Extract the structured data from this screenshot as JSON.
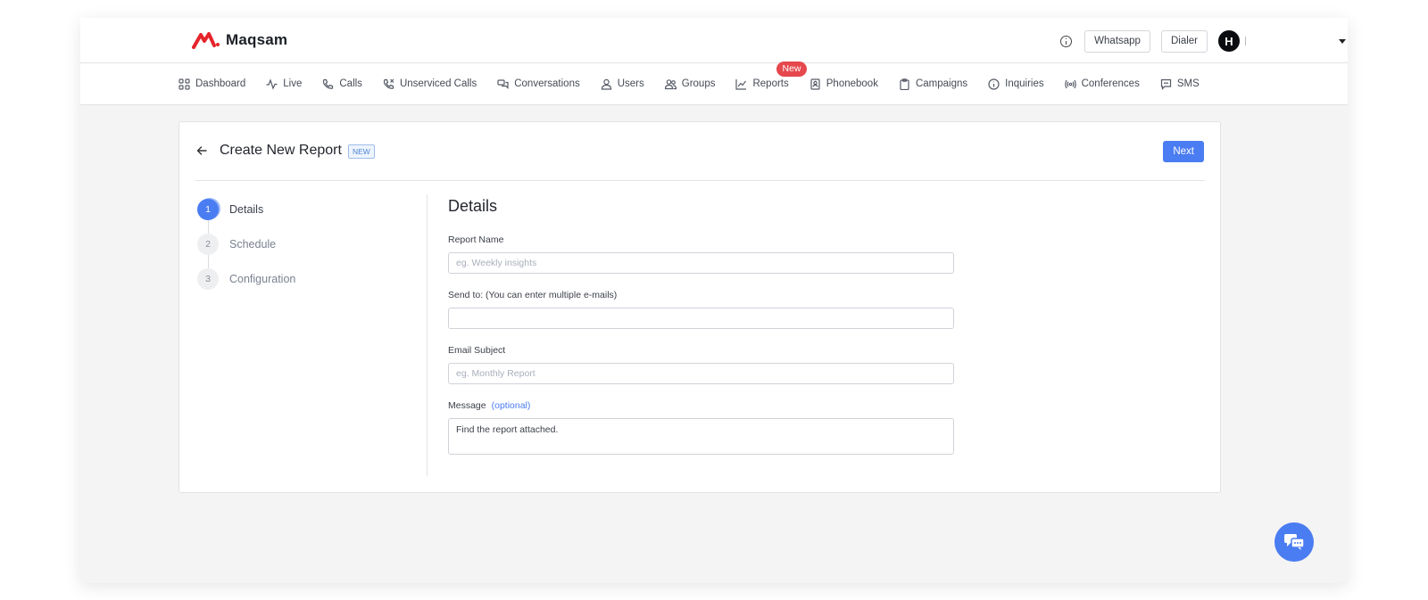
{
  "brand": {
    "name": "Maqsam",
    "color": "#e5242b"
  },
  "header": {
    "whatsapp_label": "Whatsapp",
    "dialer_label": "Dialer",
    "avatar_initial": "H"
  },
  "nav": {
    "items": [
      {
        "label": "Dashboard",
        "icon": "grid-icon"
      },
      {
        "label": "Live",
        "icon": "pulse-icon"
      },
      {
        "label": "Calls",
        "icon": "phone-icon"
      },
      {
        "label": "Unserviced Calls",
        "icon": "phone-missed-icon"
      },
      {
        "label": "Conversations",
        "icon": "chat-bubbles-icon"
      },
      {
        "label": "Users",
        "icon": "user-icon"
      },
      {
        "label": "Groups",
        "icon": "users-icon"
      },
      {
        "label": "Reports",
        "icon": "chart-line-icon"
      },
      {
        "label": "Phonebook",
        "icon": "contact-book-icon"
      },
      {
        "label": "Campaigns",
        "icon": "clipboard-icon"
      },
      {
        "label": "Inquiries",
        "icon": "info-circle-icon"
      },
      {
        "label": "Conferences",
        "icon": "broadcast-icon"
      },
      {
        "label": "SMS",
        "icon": "message-square-icon"
      }
    ],
    "reports_badge": "New"
  },
  "page": {
    "title": "Create New Report",
    "title_badge": "NEW",
    "next_label": "Next"
  },
  "steps": [
    {
      "num": "1",
      "label": "Details",
      "active": true
    },
    {
      "num": "2",
      "label": "Schedule",
      "active": false
    },
    {
      "num": "3",
      "label": "Configuration",
      "active": false
    }
  ],
  "form": {
    "heading": "Details",
    "report_name": {
      "label": "Report Name",
      "placeholder": "eg. Weekly insights",
      "value": ""
    },
    "send_to": {
      "label": "Send to: (You can enter multiple e-mails)",
      "value": ""
    },
    "email_subject": {
      "label": "Email Subject",
      "placeholder": "eg. Monthly Report",
      "value": ""
    },
    "message": {
      "label": "Message",
      "optional": "(optional)",
      "value": "Find the report attached."
    }
  },
  "colors": {
    "accent": "#4a7cf2",
    "badge_red": "#e5484d"
  }
}
